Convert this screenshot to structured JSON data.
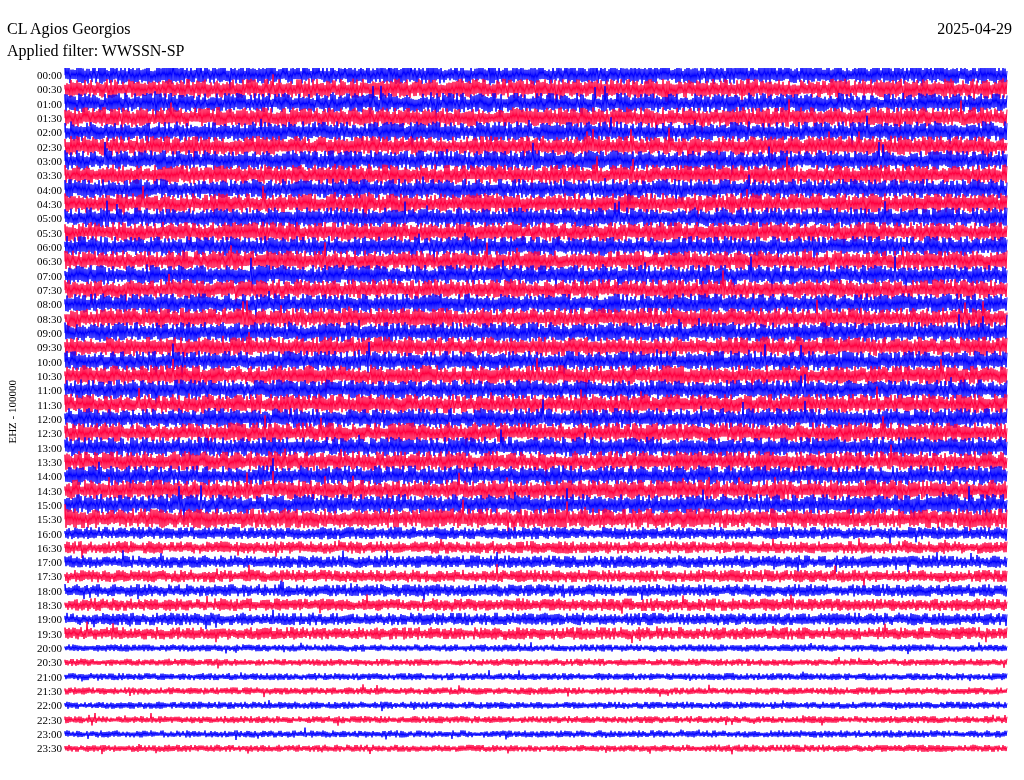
{
  "header": {
    "station": "CL Agios Georgios",
    "date": "2025-04-29",
    "filter": "Applied filter: WWSSN-SP"
  },
  "channel_label": "EHZ - 100000",
  "rows": [
    {
      "label": "00:00",
      "color": "#0000ff"
    },
    {
      "label": "00:30",
      "color": "#ff0040"
    },
    {
      "label": "01:00",
      "color": "#0000ff"
    },
    {
      "label": "01:30",
      "color": "#ff0040"
    },
    {
      "label": "02:00",
      "color": "#0000ff"
    },
    {
      "label": "02:30",
      "color": "#ff0040"
    },
    {
      "label": "03:00",
      "color": "#0000ff"
    },
    {
      "label": "03:30",
      "color": "#ff0040"
    },
    {
      "label": "04:00",
      "color": "#0000ff"
    },
    {
      "label": "04:30",
      "color": "#ff0040"
    },
    {
      "label": "05:00",
      "color": "#0000ff"
    },
    {
      "label": "05:30",
      "color": "#ff0040"
    },
    {
      "label": "06:00",
      "color": "#0000ff"
    },
    {
      "label": "06:30",
      "color": "#ff0040"
    },
    {
      "label": "07:00",
      "color": "#0000ff"
    },
    {
      "label": "07:30",
      "color": "#ff0040"
    },
    {
      "label": "08:00",
      "color": "#0000ff"
    },
    {
      "label": "08:30",
      "color": "#ff0040"
    },
    {
      "label": "09:00",
      "color": "#0000ff"
    },
    {
      "label": "09:30",
      "color": "#ff0040"
    },
    {
      "label": "10:00",
      "color": "#0000ff"
    },
    {
      "label": "10:30",
      "color": "#ff0040"
    },
    {
      "label": "11:00",
      "color": "#0000ff"
    },
    {
      "label": "11:30",
      "color": "#ff0040"
    },
    {
      "label": "12:00",
      "color": "#0000ff"
    },
    {
      "label": "12:30",
      "color": "#ff0040"
    },
    {
      "label": "13:00",
      "color": "#0000ff"
    },
    {
      "label": "13:30",
      "color": "#ff0040"
    },
    {
      "label": "14:00",
      "color": "#0000ff"
    },
    {
      "label": "14:30",
      "color": "#ff0040"
    },
    {
      "label": "15:00",
      "color": "#0000ff"
    },
    {
      "label": "15:30",
      "color": "#ff0040"
    },
    {
      "label": "16:00",
      "color": "#0000ff"
    },
    {
      "label": "16:30",
      "color": "#ff0040"
    },
    {
      "label": "17:00",
      "color": "#0000ff"
    },
    {
      "label": "17:30",
      "color": "#ff0040"
    },
    {
      "label": "18:00",
      "color": "#0000ff"
    },
    {
      "label": "18:30",
      "color": "#ff0040"
    },
    {
      "label": "19:00",
      "color": "#0000ff"
    },
    {
      "label": "19:30",
      "color": "#ff0040"
    },
    {
      "label": "20:00",
      "color": "#0000ff"
    },
    {
      "label": "20:30",
      "color": "#ff0040"
    },
    {
      "label": "21:00",
      "color": "#0000ff"
    },
    {
      "label": "21:30",
      "color": "#ff0040"
    },
    {
      "label": "22:00",
      "color": "#0000ff"
    },
    {
      "label": "22:30",
      "color": "#ff0040"
    },
    {
      "label": "23:00",
      "color": "#0000ff"
    },
    {
      "label": "23:30",
      "color": "#ff0040"
    }
  ]
}
